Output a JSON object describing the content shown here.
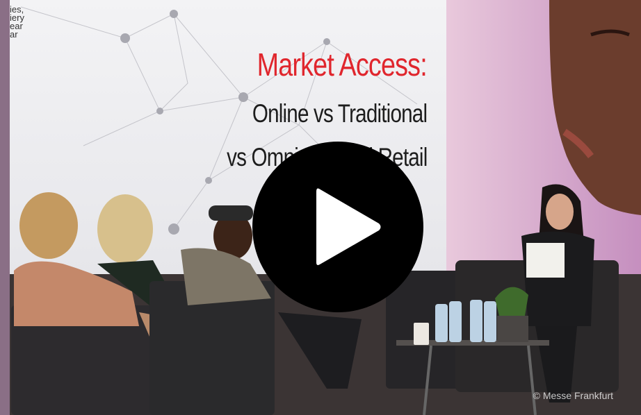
{
  "slide": {
    "headline": "Market Access:",
    "line1": "Online vs Traditional",
    "line2": "vs Omni-channel Retail",
    "logo_fragment": "ies,\niery\near\nar"
  },
  "watermark": "© Messe Frankfurt",
  "play_button": {
    "icon": "play-icon",
    "label": "Play video"
  },
  "colors": {
    "headline": "#e0262d",
    "play_bg": "#000000",
    "play_triangle": "#ffffff"
  }
}
